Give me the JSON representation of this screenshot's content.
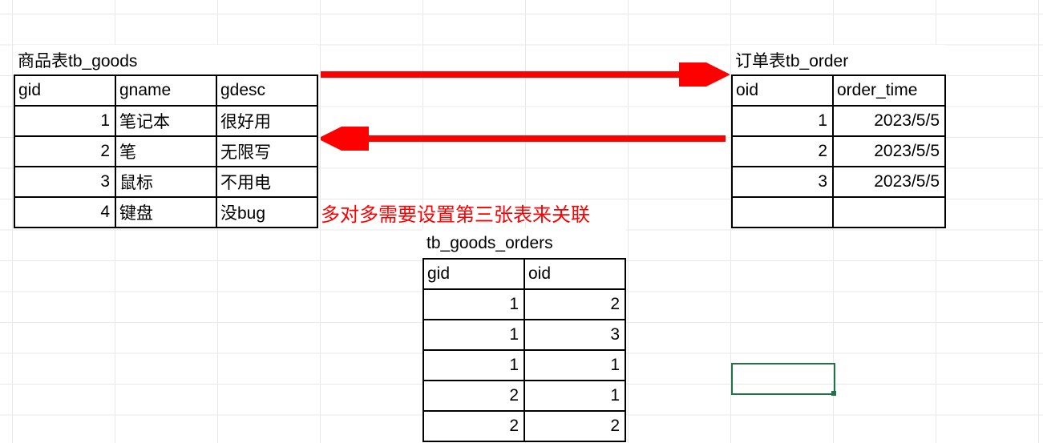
{
  "goods_table": {
    "title": "商品表tb_goods",
    "headers": [
      "gid",
      "gname",
      "gdesc"
    ],
    "rows": [
      {
        "gid": "1",
        "gname": "笔记本",
        "gdesc": "很好用"
      },
      {
        "gid": "2",
        "gname": "笔",
        "gdesc": "无限写"
      },
      {
        "gid": "3",
        "gname": "鼠标",
        "gdesc": "不用电"
      },
      {
        "gid": "4",
        "gname": "键盘",
        "gdesc": "没bug"
      }
    ]
  },
  "order_table": {
    "title": "订单表tb_order",
    "headers": [
      "oid",
      "order_time"
    ],
    "rows": [
      {
        "oid": "1",
        "order_time": "2023/5/5"
      },
      {
        "oid": "2",
        "order_time": "2023/5/5"
      },
      {
        "oid": "3",
        "order_time": "2023/5/5"
      }
    ]
  },
  "link_table": {
    "title": "tb_goods_orders",
    "headers": [
      "gid",
      "oid"
    ],
    "rows": [
      {
        "gid": "1",
        "oid": "2"
      },
      {
        "gid": "1",
        "oid": "3"
      },
      {
        "gid": "1",
        "oid": "1"
      },
      {
        "gid": "2",
        "oid": "1"
      },
      {
        "gid": "2",
        "oid": "2"
      }
    ]
  },
  "annotation_text": "多对多需要设置第三张表来关联",
  "colors": {
    "arrow": "#ff0000",
    "annotation": "#ff0000"
  }
}
